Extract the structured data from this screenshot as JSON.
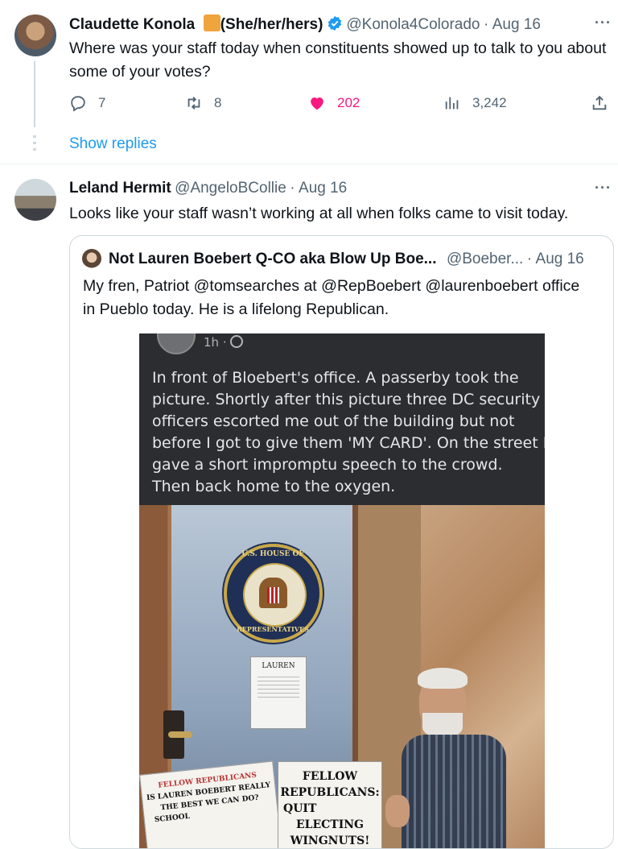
{
  "tweet1": {
    "author_name": "Claudette Konola",
    "pronouns": "(She/her/hers)",
    "flag_color": "#f0a43c",
    "handle": "@Konola4Colorado",
    "separator": "·",
    "date": "Aug 16",
    "text": "Where was your staff today when constituents showed up to talk to you about some of your votes?",
    "actions": {
      "replies": "7",
      "retweets": "8",
      "likes": "202",
      "views": "3,242"
    },
    "show_replies": "Show replies",
    "more": "···"
  },
  "tweet2": {
    "author_name": "Leland Hermit",
    "handle": "@AngeloBCollie",
    "separator": "·",
    "date": "Aug 16",
    "text": "Looks like your staff wasn’t working at all when folks came to visit today.",
    "more": "···"
  },
  "quote": {
    "author_name": "Not Lauren Boebert Q-CO aka Blow Up Boe...",
    "handle": "@Boeber...",
    "separator": "·",
    "date": "Aug 16",
    "text_line1": "My fren, Patriot @tomsearches at @RepBoebert @laurenboebert office",
    "text_line2": "in Pueblo today. He is a lifelong Republican.",
    "embedded_post": {
      "time": "1h ·",
      "lines": [
        "In front of Bloebert's office. A passerby took the",
        "picture. Shortly after this picture three DC security",
        "officers escorted me out of the building but not",
        "before I got to give them 'MY CARD'. On the street I",
        "gave a short impromptu speech to the crowd.",
        "Then back home to the oxygen."
      ]
    },
    "photo": {
      "seal_text_top": "U.S. HOUSE OF",
      "seal_text_bottom": "REPRESENTATIVES",
      "nameplate": "LAUREN",
      "sign1": [
        "FELLOW REPUBLICANS",
        "IS LAUREN BOEBERT REALLY",
        "THE BEST WE CAN DO?",
        "SCHOOL"
      ],
      "sign2": [
        "FELLOW",
        "REPUBLICANS:",
        "QUIT",
        "ELECTING",
        "WINGNUTS!"
      ]
    }
  },
  "colors": {
    "accent": "#1d9bf0",
    "like": "#f91880",
    "muted": "#536471"
  }
}
